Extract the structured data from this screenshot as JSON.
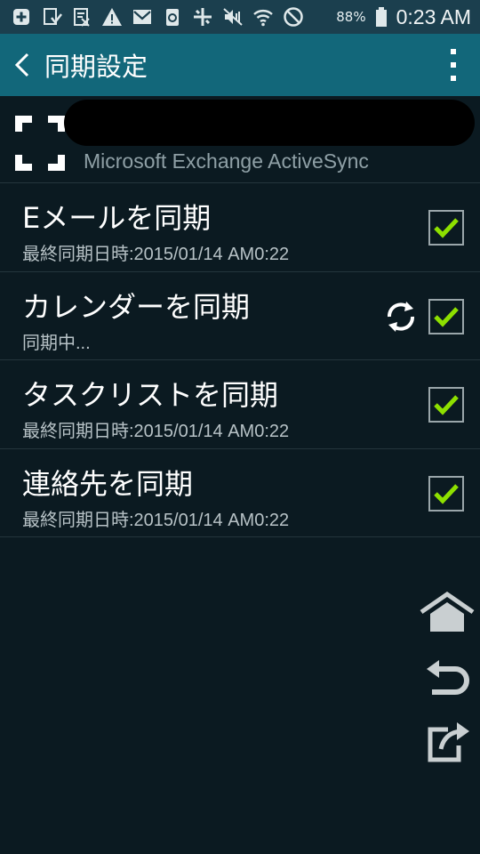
{
  "status_bar": {
    "battery_percent": "88%",
    "time": "0:23 AM",
    "icons": [
      "add-icon",
      "download-icon",
      "calendar-icon",
      "warning-icon",
      "mail-icon",
      "recycle-icon",
      "data-sync-icon",
      "mute-icon",
      "wifi-icon",
      "blocked-icon",
      "battery-icon"
    ]
  },
  "header": {
    "title": "同期設定",
    "back_icon": "chevron-left-icon",
    "menu_icon": "overflow-menu-icon"
  },
  "account": {
    "icon": "exchange-account-icon",
    "type": "Microsoft Exchange ActiveSync"
  },
  "sync_items": [
    {
      "title": "Eメールを同期",
      "subtitle": "最終同期日時:2015/01/14 AM0:22",
      "checked": true,
      "syncing": false
    },
    {
      "title": "カレンダーを同期",
      "subtitle": "同期中...",
      "checked": true,
      "syncing": true
    },
    {
      "title": "タスクリストを同期",
      "subtitle": "最終同期日時:2015/01/14 AM0:22",
      "checked": true,
      "syncing": false
    },
    {
      "title": "連絡先を同期",
      "subtitle": "最終同期日時:2015/01/14 AM0:22",
      "checked": true,
      "syncing": false
    }
  ],
  "side_buttons": [
    "home-icon",
    "undo-icon",
    "share-icon"
  ],
  "colors": {
    "status_bar": "#1b3f4e",
    "action_bar": "#12677a",
    "background": "#0b1a21",
    "check_green": "#8ee000",
    "divider": "#24353c"
  }
}
